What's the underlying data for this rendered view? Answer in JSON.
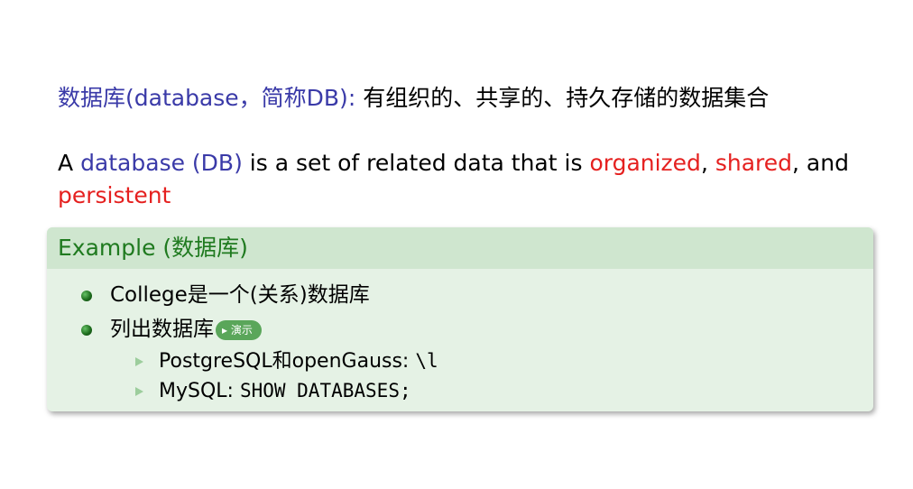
{
  "definition_zh": {
    "term": "数据库(database，简称DB)",
    "colon": ":",
    "rest": " 有组织的、共享的、持久存储的数据集合"
  },
  "definition_en": {
    "prefix": "A ",
    "term": "database (DB)",
    "mid": " is a set of related data that is ",
    "kw1": "organized",
    "sep1": ", ",
    "kw2": "shared",
    "sep2": ", and ",
    "kw3": "persistent"
  },
  "example_block": {
    "title": "Example (数据库)",
    "items": [
      {
        "text": "College是一个(关系)数据库"
      },
      {
        "text": "列出数据库",
        "button_label": "▸ 演示"
      }
    ],
    "subitems": [
      {
        "label": "PostgreSQL和openGauss: ",
        "code": "\\l"
      },
      {
        "label": "MySQL: ",
        "code": "SHOW DATABASES;"
      }
    ]
  },
  "colors": {
    "term_blue": "#3a3aa8",
    "keyword_red": "#e5201f",
    "block_title_green": "#1f7a1f",
    "block_header_bg": "#cfe6cf",
    "block_body_bg": "#e5f2e5"
  }
}
